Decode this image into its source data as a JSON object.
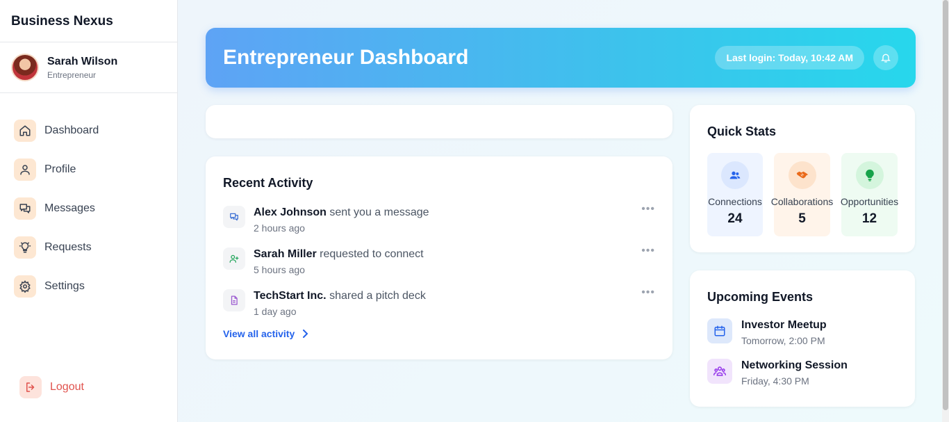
{
  "brand": "Business Nexus",
  "user": {
    "name": "Sarah Wilson",
    "role": "Entrepreneur"
  },
  "nav": [
    {
      "label": "Dashboard",
      "icon": "home-icon"
    },
    {
      "label": "Profile",
      "icon": "user-icon"
    },
    {
      "label": "Messages",
      "icon": "messages-icon"
    },
    {
      "label": "Requests",
      "icon": "lightbulb-icon"
    },
    {
      "label": "Settings",
      "icon": "gear-icon"
    }
  ],
  "logout": "Logout",
  "header": {
    "title": "Entrepreneur Dashboard",
    "last_login": "Last login: Today, 10:42 AM"
  },
  "activity": {
    "title": "Recent Activity",
    "items": [
      {
        "actor": "Alex Johnson",
        "action": "sent you a message",
        "time": "2 hours ago",
        "icon": "chat-icon"
      },
      {
        "actor": "Sarah Miller",
        "action": "requested to connect",
        "time": "5 hours ago",
        "icon": "user-plus-icon"
      },
      {
        "actor": "TechStart Inc.",
        "action": "shared a pitch deck",
        "time": "1 day ago",
        "icon": "document-icon"
      }
    ],
    "more": "•••",
    "view_all": "View all activity"
  },
  "stats": {
    "title": "Quick Stats",
    "items": [
      {
        "label": "Connections",
        "value": "24",
        "icon": "users-icon",
        "bg": "#eef4ff",
        "icon_bg": "#dbe7fe",
        "color": "#2563eb"
      },
      {
        "label": "Collaborations",
        "value": "5",
        "icon": "handshake-icon",
        "bg": "#fff4ea",
        "icon_bg": "#fde3cc",
        "color": "#ea6a1a"
      },
      {
        "label": "Opportunities",
        "value": "12",
        "icon": "lightbulb-icon",
        "bg": "#eefbf2",
        "icon_bg": "#d4f5dd",
        "color": "#16a34a"
      }
    ]
  },
  "events": {
    "title": "Upcoming Events",
    "items": [
      {
        "title": "Investor Meetup",
        "time": "Tomorrow, 2:00 PM",
        "icon": "calendar-icon",
        "bg": "#dde8fb",
        "color": "#2563eb"
      },
      {
        "title": "Networking Session",
        "time": "Friday, 4:30 PM",
        "icon": "group-icon",
        "bg": "#f1e4fc",
        "color": "#9333ea"
      }
    ]
  },
  "colors": {
    "accent": "#3b82f6",
    "nav_icon_bg": "#fde7d2",
    "logout": "#e0524d"
  }
}
